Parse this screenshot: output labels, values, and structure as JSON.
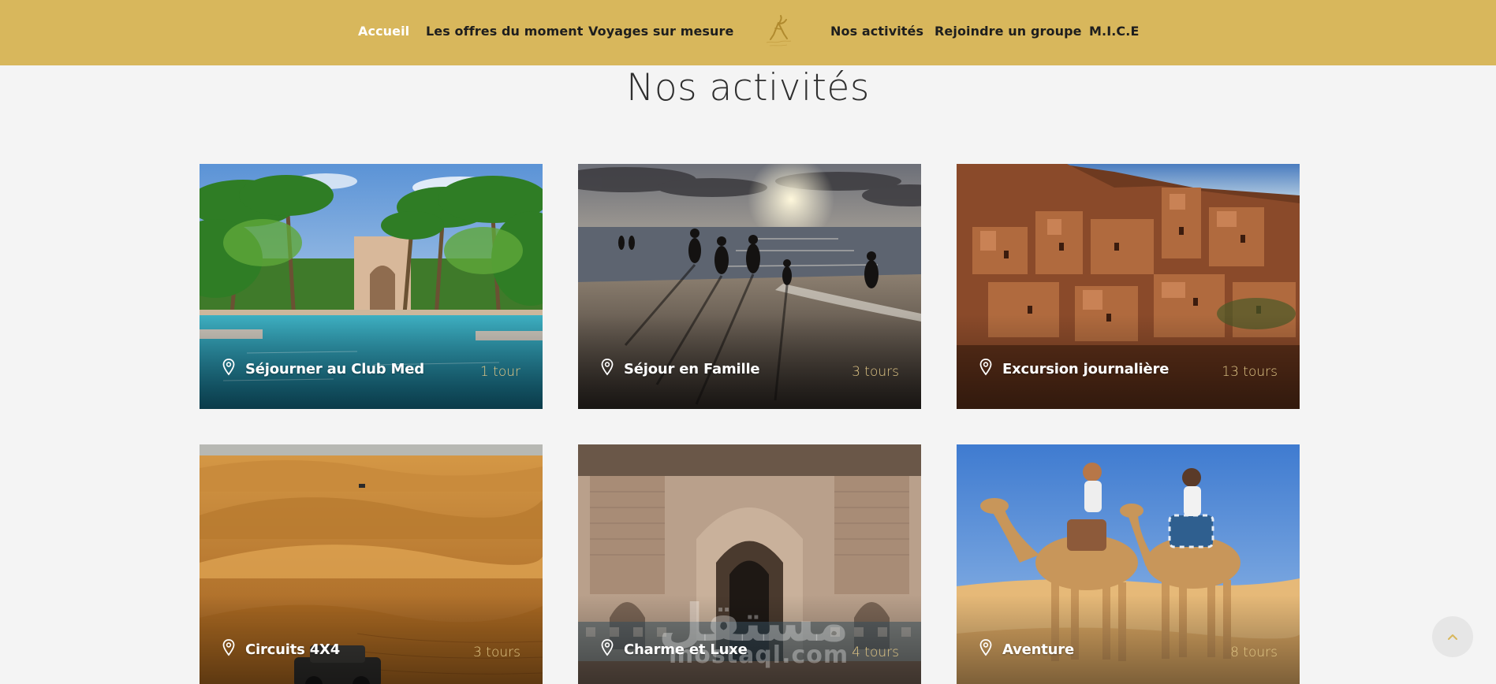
{
  "nav": {
    "items": [
      {
        "label": "Accueil",
        "active": true
      },
      {
        "label": "Les offres du moment",
        "active": false
      },
      {
        "label": "Voyages sur mesure",
        "active": false
      },
      {
        "label": "Nos activités",
        "active": false
      },
      {
        "label": "Rejoindre un groupe",
        "active": false
      },
      {
        "label": "M.I.C.E",
        "active": false
      }
    ]
  },
  "page": {
    "title": "Nos activités"
  },
  "cards": [
    {
      "title": "Séjourner au Club Med",
      "count": "1 tour",
      "icon": "map-pin-icon"
    },
    {
      "title": "Séjour en Famille",
      "count": "3 tours",
      "icon": "map-pin-icon"
    },
    {
      "title": "Excursion journalière",
      "count": "13 tours",
      "icon": "map-pin-icon"
    },
    {
      "title": "Circuits 4X4",
      "count": "3 tours",
      "icon": "map-pin-icon"
    },
    {
      "title": "Charme et Luxe",
      "count": "4 tours",
      "icon": "map-pin-icon"
    },
    {
      "title": "Aventure",
      "count": "8 tours",
      "icon": "map-pin-icon"
    }
  ],
  "watermark": {
    "arabic": "مستقل",
    "latin": "mostaql.com"
  },
  "colors": {
    "header_bg": "#d8b75c",
    "nav_active": "#ffffff",
    "nav_text": "#1e1e1e",
    "page_bg": "#f4f4f4",
    "tour_count": "#e0c686"
  }
}
